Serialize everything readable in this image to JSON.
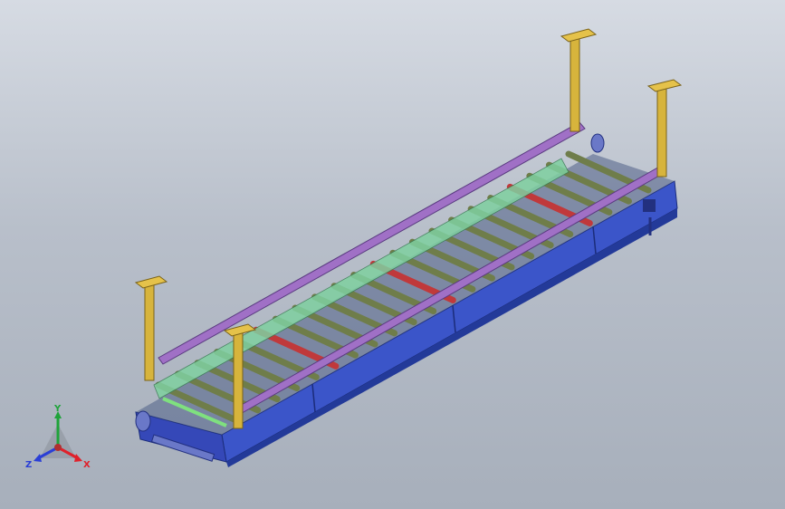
{
  "view": {
    "colors": {
      "background_top": "#d6dbe3",
      "background_bottom": "#a7afbb",
      "frame_blue": "#3b55c9",
      "frame_blue_dark": "#233a99",
      "roller_green": "#6f7d4a",
      "roller_red": "#c0393b",
      "rail_purple": "#a070c6",
      "rail_green": "#7fd0a0",
      "post_yellow": "#d7b43c"
    }
  },
  "triad": {
    "x_label": "X",
    "y_label": "Y",
    "z_label": "Z",
    "x_color": "#e0212b",
    "y_color": "#1fa33a",
    "z_color": "#2a3fd6"
  }
}
